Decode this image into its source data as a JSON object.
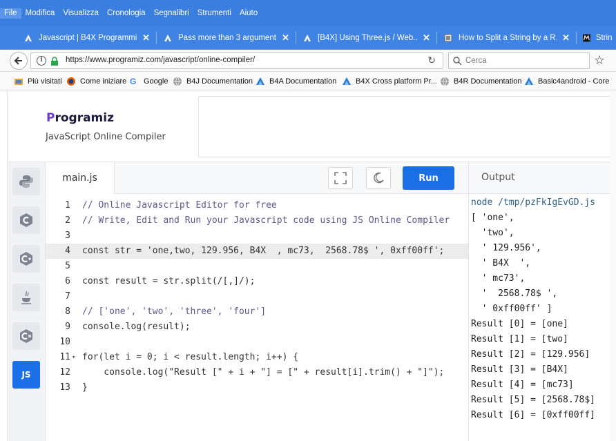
{
  "browser": {
    "menu": [
      "File",
      "Modifica",
      "Visualizza",
      "Cronologia",
      "Segnalibri",
      "Strumenti",
      "Aiuto"
    ],
    "tabs": [
      {
        "label": "Javascript | B4X Programmi...",
        "icon": "b4x-icon"
      },
      {
        "label": "Pass more than 3 argument...",
        "icon": "b4x-icon"
      },
      {
        "label": "[B4X] Using Three.js / Web...",
        "icon": "b4x-icon"
      },
      {
        "label": "How to Split a String by a R...",
        "icon": "page-icon"
      },
      {
        "label": "Strin",
        "icon": "m-icon"
      }
    ],
    "close_glyph": "✕",
    "url": "https://www.programiz.com/javascript/online-compiler/",
    "search_placeholder": "Cerca",
    "bookmarks": [
      {
        "label": "Più visitati"
      },
      {
        "label": "Come iniziare"
      },
      {
        "label": "Google"
      },
      {
        "label": "B4J Documentation"
      },
      {
        "label": "B4A Documentation"
      },
      {
        "label": "B4X Cross platform Pr..."
      },
      {
        "label": "B4R Documentation"
      },
      {
        "label": "Basic4android - Core"
      }
    ]
  },
  "site": {
    "logo_initial": "P",
    "logo_rest": "rogramiz",
    "subtitle": "JavaScript Online Compiler"
  },
  "sidebar": {
    "active_label": "JS"
  },
  "editor": {
    "file_tab": "main.js",
    "run_label": "Run",
    "lines": [
      {
        "n": "1",
        "text": "// Online Javascript Editor for free"
      },
      {
        "n": "2",
        "text": "// Write, Edit and Run your Javascript code using JS Online Compiler"
      },
      {
        "n": "3",
        "text": ""
      },
      {
        "n": "4",
        "text": "const str = 'one,two, 129.956, B4X  , mc73,  2568.78$ ', 0xff00ff';"
      },
      {
        "n": "5",
        "text": ""
      },
      {
        "n": "6",
        "text": "const result = str.split(/[,]/);"
      },
      {
        "n": "7",
        "text": ""
      },
      {
        "n": "8",
        "text": "// ['one', 'two', 'three', 'four']"
      },
      {
        "n": "9",
        "text": "console.log(result);"
      },
      {
        "n": "10",
        "text": ""
      },
      {
        "n": "11",
        "text": "for(let i = 0; i < result.length; i++) {"
      },
      {
        "n": "12",
        "text": "    console.log(\"Result [\" + i + \"] = [\" + result[i].trim() + \"]\");"
      },
      {
        "n": "13",
        "text": "}"
      }
    ]
  },
  "output": {
    "title": "Output",
    "lines": [
      "node /tmp/pzFkIgEvGD.js",
      "[ 'one',",
      "  'two',",
      "  ' 129.956',",
      "  ' B4X  ',",
      "  ' mc73',",
      "  '  2568.78$ ',",
      "  ' 0xff00ff' ]",
      "Result [0] = [one]",
      "Result [1] = [two]",
      "Result [2] = [129.956]",
      "Result [3] = [B4X]",
      "Result [4] = [mc73]",
      "Result [5] = [2568.78$]",
      "Result [6] = [0xff00ff]"
    ]
  },
  "colors": {
    "chrome_blue": "#3a7ee0",
    "run_blue": "#1b6fe4",
    "brand_purple": "#6a3dd1"
  }
}
